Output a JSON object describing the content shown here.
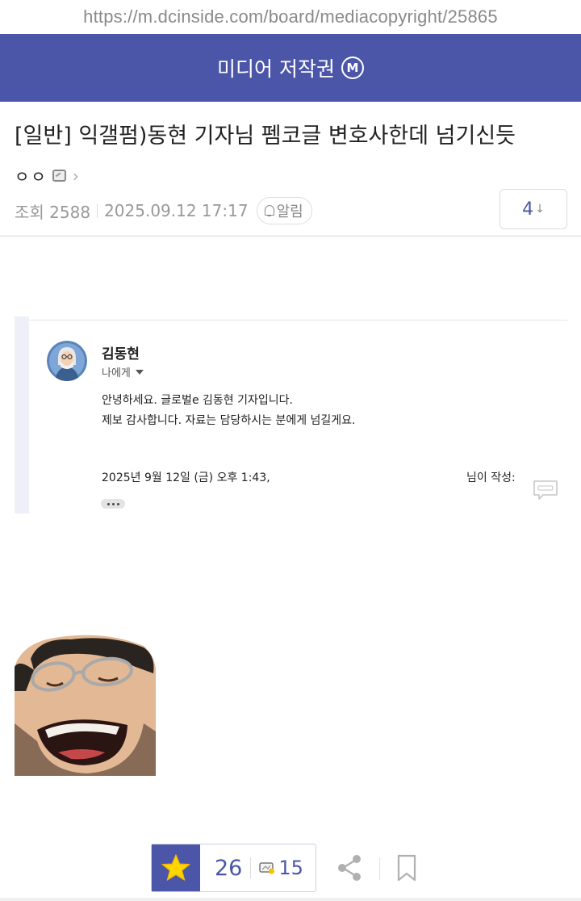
{
  "browser": {
    "url": "https://m.dcinside.com/board/mediacopyright/25865"
  },
  "gallery": {
    "title": "미디어 저작권",
    "badge": "M"
  },
  "post": {
    "title": "[일반] 익갤펌)동현 기자님 펨코글 변호사한데 넘기신듯",
    "author": "ㅇㅇ",
    "views_label": "조회 2588",
    "date": "2025.09.12 17:17",
    "alarm_label": "알림",
    "comment_count": "4",
    "comment_arrow": "↓"
  },
  "email": {
    "sender": "김동현",
    "recipient": "나에게",
    "body_lines": [
      "안녕하세요. 글로벌e 김동현 기자입니다.",
      "제보 감사합니다. 자료는 담당하시는 분에게 넘길게요."
    ],
    "quote_date": "2025년 9월 12일 (금) 오후 1:43,",
    "quote_author": "님이 작성:"
  },
  "actions": {
    "recommend_count": "26",
    "fix_count": "15"
  },
  "colors": {
    "brand": "#4b56a8",
    "star": "#ffd600"
  },
  "icons": [
    "m-badge-icon",
    "ip-icon",
    "chevron-right-icon",
    "bell-icon",
    "arrow-down-icon",
    "caret-down-icon",
    "chat-icon",
    "star-icon",
    "fix-icon",
    "share-icon",
    "bookmark-icon"
  ]
}
